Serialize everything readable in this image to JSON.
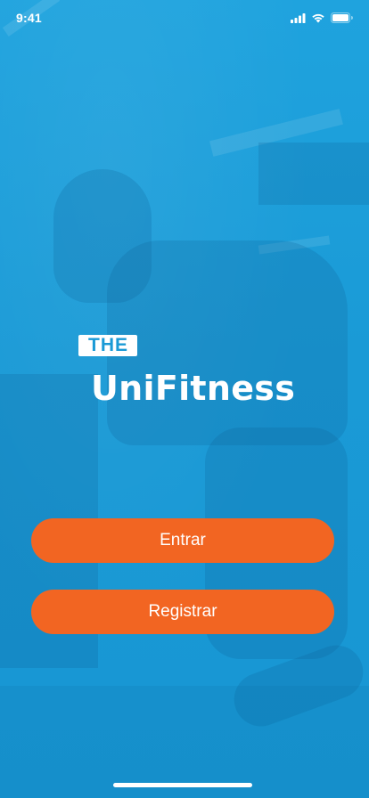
{
  "status_bar": {
    "time": "9:41",
    "icons": [
      "cellular-signal-icon",
      "wifi-icon",
      "battery-icon"
    ]
  },
  "logo": {
    "badge_text": "THE",
    "title": "UniFitness"
  },
  "actions": {
    "login_label": "Entrar",
    "register_label": "Registrar"
  },
  "colors": {
    "background_tint": "#1a9ad6",
    "button": "#f26522",
    "text": "#ffffff"
  }
}
